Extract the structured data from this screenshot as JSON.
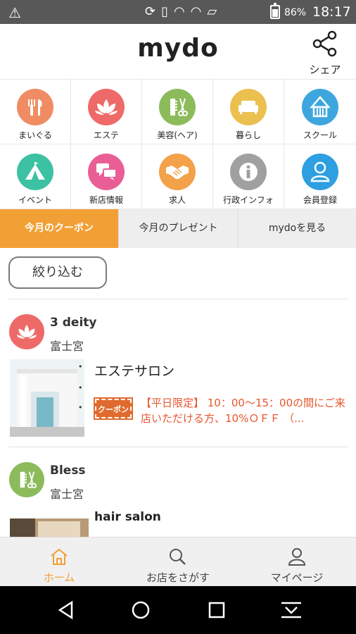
{
  "status_bar": {
    "warning_icon": "warning-icon",
    "icons": [
      "sync-icon",
      "nfc-icon",
      "wifi-call-icon",
      "wifi-icon",
      "no-sim-icon"
    ],
    "battery_percent": "86%",
    "time": "18:17"
  },
  "header": {
    "logo": "mydo",
    "share_label": "シェア"
  },
  "categories": [
    {
      "label": "まいぐる",
      "icon": "fork-knife-icon",
      "color": "#f08c63"
    },
    {
      "label": "エステ",
      "icon": "lotus-icon",
      "color": "#ee6a68"
    },
    {
      "label": "美容(ヘア)",
      "icon": "comb-scissors-icon",
      "color": "#8cbb5b"
    },
    {
      "label": "暮らし",
      "icon": "sofa-icon",
      "color": "#ebc04f"
    },
    {
      "label": "スクール",
      "icon": "school-icon",
      "color": "#3ea6de"
    },
    {
      "label": "イベント",
      "icon": "tent-icon",
      "color": "#3cc1a3"
    },
    {
      "label": "新店情報",
      "icon": "chat-icon",
      "color": "#e95f95"
    },
    {
      "label": "求人",
      "icon": "handshake-icon",
      "color": "#f3a24a"
    },
    {
      "label": "行政インフォ",
      "icon": "info-icon",
      "color": "#a0a0a0"
    },
    {
      "label": "会員登録",
      "icon": "user-icon",
      "color": "#2e9fe0"
    }
  ],
  "tabs": [
    {
      "label": "今月のクーポン",
      "active": true
    },
    {
      "label": "今月のプレゼント",
      "active": false
    },
    {
      "label": "mydoを見る",
      "active": false
    }
  ],
  "filter_button": "絞り込む",
  "shops": [
    {
      "name": "3 deity",
      "area": "富士宮",
      "category": "エステサロン",
      "avatar_icon": "lotus-icon",
      "avatar_color": "#ee6a68",
      "badge": "クーポン",
      "description": "【平日限定】 10：00〜15：00の間にご来店いただける方、10%ＯＦＦ （..."
    },
    {
      "name": "Bless",
      "area": "富士宮",
      "category": "hair salon",
      "avatar_icon": "comb-scissors-icon",
      "avatar_color": "#8cbb5b"
    }
  ],
  "bottom_nav": [
    {
      "label": "ホーム",
      "icon": "home-icon",
      "active": true
    },
    {
      "label": "お店をさがす",
      "icon": "search-icon",
      "active": false
    },
    {
      "label": "マイページ",
      "icon": "person-icon",
      "active": false
    }
  ],
  "system_nav": [
    "back-icon",
    "home-circle-icon",
    "recents-icon",
    "download-icon"
  ],
  "colors": {
    "accent": "#f2a036",
    "coupon_text": "#e8552e",
    "statusbar": "#585858"
  }
}
